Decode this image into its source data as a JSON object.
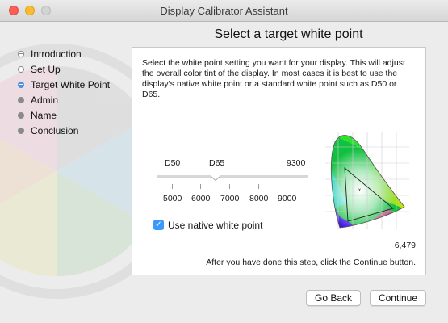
{
  "window": {
    "title": "Display Calibrator Assistant"
  },
  "heading": "Select a target white point",
  "steps": [
    {
      "label": "Introduction",
      "state": "done"
    },
    {
      "label": "Set Up",
      "state": "done"
    },
    {
      "label": "Target White Point",
      "state": "current"
    },
    {
      "label": "Admin",
      "state": "pending"
    },
    {
      "label": "Name",
      "state": "pending"
    },
    {
      "label": "Conclusion",
      "state": "pending"
    }
  ],
  "panel": {
    "description_lines": [
      "Select the white point setting you want for your display.  This will adjust",
      "the overall color tint of the display.  In most cases it is best to use the",
      "display's native white point or a standard white point such as D50 or",
      "D65."
    ],
    "slider": {
      "top_labels": [
        "D50",
        "D65",
        "9300"
      ],
      "bottom_labels": [
        "5000",
        "6000",
        "7000",
        "8000",
        "9000"
      ],
      "value_kelvin": 6479
    },
    "native_checkbox": {
      "label": "Use native white point",
      "checked": true
    },
    "white_point_value": "6,479",
    "footer_note": "After you have done this step, click the Continue button."
  },
  "buttons": {
    "back": "Go Back",
    "continue": "Continue"
  },
  "colors": {
    "accent": "#3b99fc",
    "close": "#fc5f57",
    "minimize": "#fdbc2e",
    "zoom_disabled": "#d3d3d3"
  },
  "icons": {
    "close": "close-icon",
    "minimize": "minimize-icon",
    "zoom": "zoom-icon",
    "checkmark": "checkmark-icon"
  }
}
